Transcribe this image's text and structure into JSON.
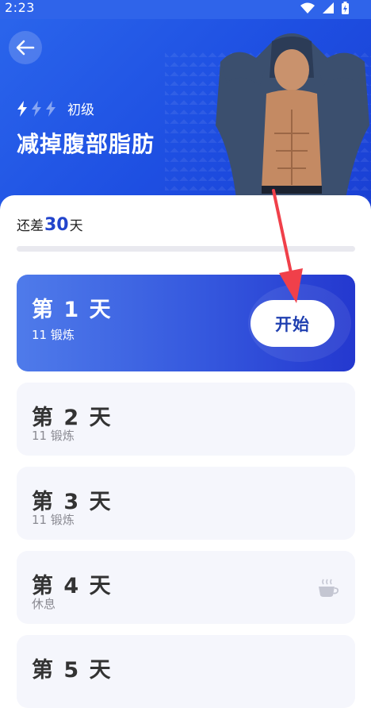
{
  "status_bar": {
    "time": "2:23"
  },
  "header": {
    "level": "初级",
    "title": "减掉腹部脂肪"
  },
  "progress": {
    "prefix": "还差",
    "remaining_days": "30",
    "suffix": "天",
    "completed_fraction": 0
  },
  "days": [
    {
      "title": "第 1 天",
      "subtitle": "11 锻炼",
      "action": "开始"
    },
    {
      "title": "第 2 天",
      "subtitle": "11 锻炼"
    },
    {
      "title": "第 3 天",
      "subtitle": "11 锻炼"
    },
    {
      "title": "第 4 天",
      "subtitle": "休息"
    },
    {
      "title": "第 5 天"
    }
  ],
  "colors": {
    "accent": "#2f5be4",
    "hero_bg": "#1e4fe2",
    "annotation": "#f0404a"
  },
  "icons": {
    "back": "arrow-left-icon",
    "level": "lightning-bolt-icon",
    "rest": "coffee-cup-icon"
  }
}
